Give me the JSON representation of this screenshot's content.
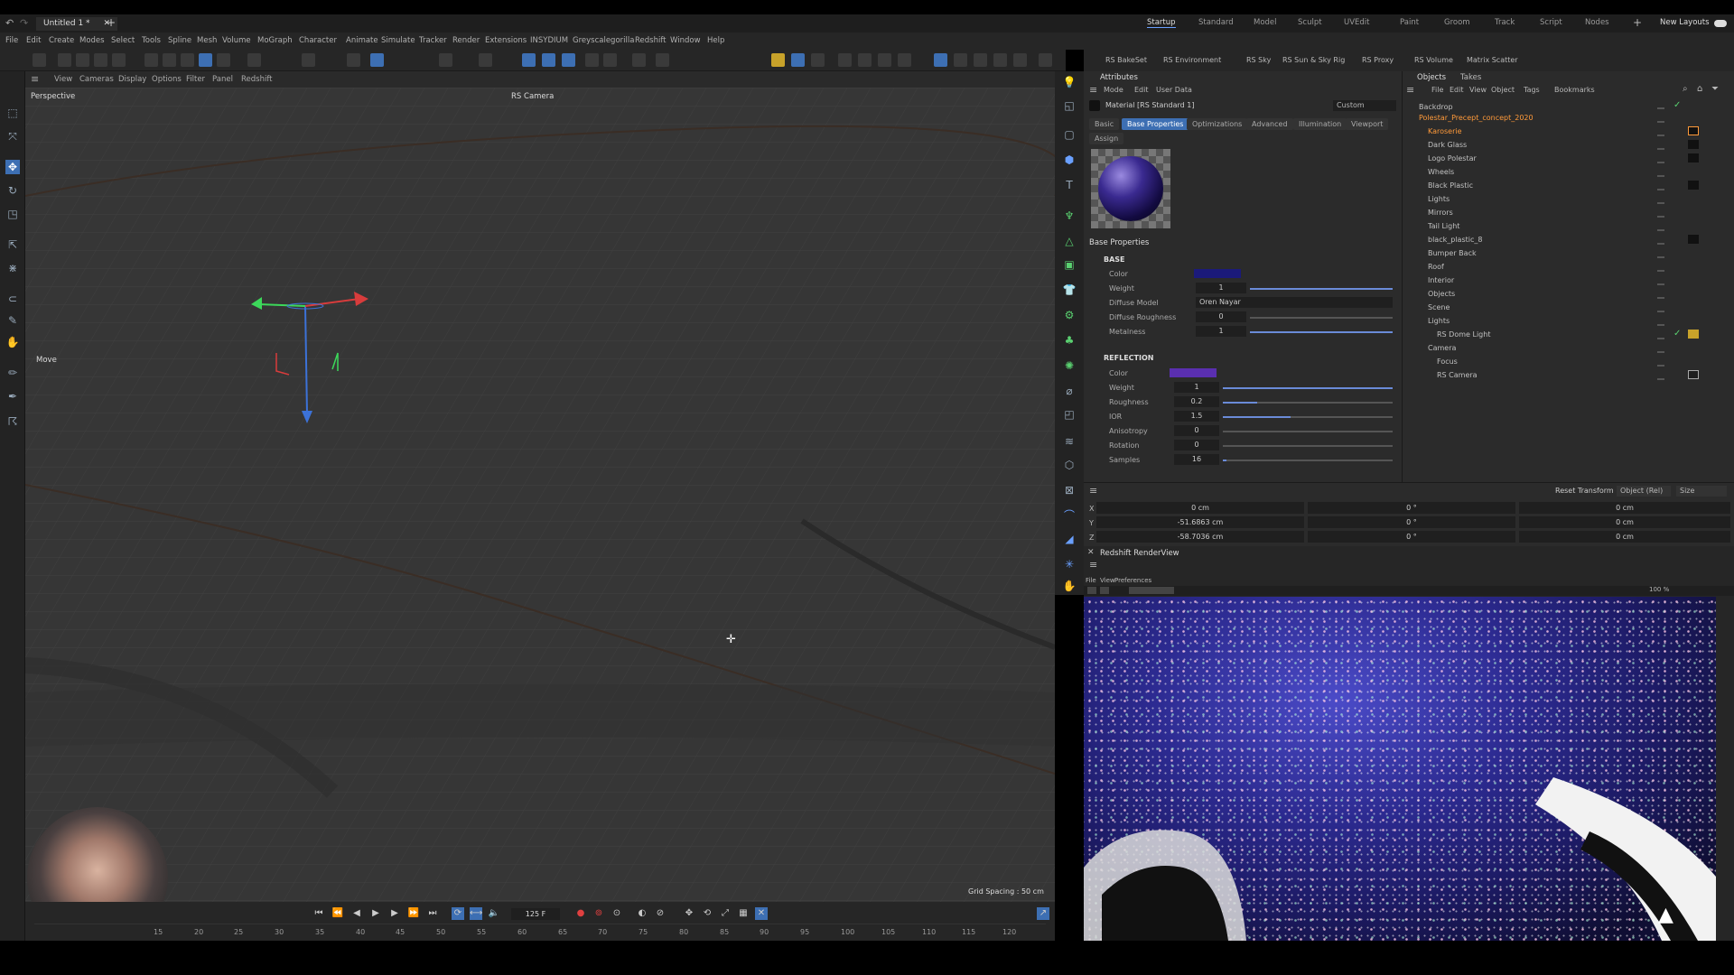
{
  "title_bar": {
    "tab_title": "Untitled 1 *",
    "layouts": [
      "Startup",
      "Standard",
      "Model",
      "Sculpt",
      "UVEdit",
      "Paint",
      "Groom",
      "Track",
      "Script",
      "Nodes"
    ],
    "active_layout": "Startup",
    "new_layouts_label": "New Layouts"
  },
  "menu": [
    "File",
    "Edit",
    "Create",
    "Modes",
    "Select",
    "Tools",
    "Spline",
    "Mesh",
    "Volume",
    "MoGraph",
    "Character",
    "Animate",
    "Simulate",
    "Tracker",
    "Render",
    "Extensions",
    "INSYDIUM",
    "Greyscalegorilla",
    "Redshift",
    "Window",
    "Help"
  ],
  "redshift_toolbar": [
    "RS BakeSet",
    "RS Environment",
    "RS Sky",
    "RS Sun & Sky Rig",
    "RS Proxy",
    "RS Volume",
    "Matrix Scatter"
  ],
  "viewport": {
    "menu": [
      "View",
      "Cameras",
      "Display",
      "Options",
      "Filter",
      "Panel",
      "Redshift"
    ],
    "name": "Perspective",
    "camera": "RS Camera",
    "tool_label": "Move",
    "grid_spacing": "Grid Spacing : 50 cm"
  },
  "timeline": {
    "current_frame": "125 F",
    "ruler": [
      "15",
      "20",
      "25",
      "30",
      "35",
      "40",
      "45",
      "50",
      "55",
      "60",
      "65",
      "70",
      "75",
      "80",
      "85",
      "90",
      "95",
      "100",
      "105",
      "110",
      "115",
      "120"
    ]
  },
  "attributes": {
    "header": "Attributes",
    "menu": [
      "Mode",
      "Edit",
      "User Data"
    ],
    "material": "Material [RS Standard 1]",
    "preset": "Custom",
    "tabs": [
      "Basic",
      "Base Properties",
      "Optimizations",
      "Advanced",
      "Illumination",
      "Viewport"
    ],
    "active_tab": "Base Properties",
    "assign": "Assign",
    "section_title": "Base Properties",
    "base": {
      "heading": "BASE",
      "color_label": "Color",
      "color": "#1b1a7a",
      "weight_label": "Weight",
      "weight": "1",
      "diffuse_model_label": "Diffuse Model",
      "diffuse_model": "Oren Nayar",
      "diffuse_roughness_label": "Diffuse Roughness",
      "diffuse_roughness": "0",
      "metalness_label": "Metalness",
      "metalness": "1"
    },
    "reflection": {
      "heading": "REFLECTION",
      "color_label": "Color",
      "color": "#5a2fb0",
      "weight_label": "Weight",
      "weight": "1",
      "roughness_label": "Roughness",
      "roughness": "0.2",
      "ior_label": "IOR",
      "ior": "1.5",
      "anisotropy_label": "Anisotropy",
      "anisotropy": "0",
      "rotation_label": "Rotation",
      "rotation": "0",
      "samples_label": "Samples",
      "samples": "16"
    }
  },
  "objects": {
    "tabs": [
      "Objects",
      "Takes"
    ],
    "menu": [
      "File",
      "Edit",
      "View",
      "Object",
      "Tags",
      "Bookmarks"
    ],
    "items": [
      "Backdrop",
      "Polestar_Precept_concept_2020",
      "Karoserie",
      "Dark Glass",
      "Logo Polestar",
      "Wheels",
      "Black Plastic",
      "Lights",
      "Mirrors",
      "Tail Light",
      "black_plastic_8",
      "Bumper Back",
      "Roof",
      "Interior",
      "Objects",
      "Scene",
      "Lights",
      "RS Dome Light",
      "Camera",
      "Focus",
      "RS Camera"
    ]
  },
  "coordinates": {
    "reset_label": "Reset Transform",
    "mode": "Object (Rel)",
    "size_mode": "Size",
    "axes": [
      "X",
      "Y",
      "Z"
    ],
    "position": [
      "0 cm",
      "-51.6863 cm",
      "-58.7036 cm"
    ],
    "rotation": [
      "0 °",
      "0 °",
      "0 °"
    ],
    "size": [
      "0 cm",
      "0 cm",
      "0 cm"
    ]
  },
  "render_view": {
    "title": "Redshift RenderView",
    "menu": [
      "File",
      "View",
      "Preferences"
    ],
    "zoom": "100 %"
  }
}
